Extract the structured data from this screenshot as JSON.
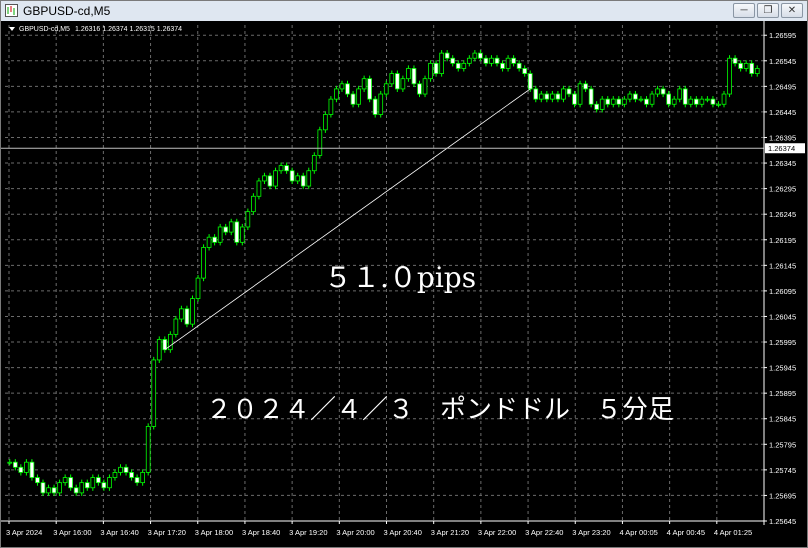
{
  "window": {
    "title": "GBPUSD-cd,M5",
    "buttons": [
      "minimize",
      "restore",
      "close"
    ]
  },
  "chart_header": {
    "symbol": "GBPUSD-cd,M5",
    "ohlc": "1.26316 1.26374 1.26315 1.26374"
  },
  "annotations": {
    "pips_label": "５１.０pips",
    "caption": "２０２４／４／３　ポンドドル　５分足"
  },
  "colors": {
    "background": "#000000",
    "grid": "#6b6b6b",
    "candle": "#00ff00",
    "axis_text": "#ffffff"
  },
  "chart_data": {
    "type": "candlestick",
    "y_ticks": [
      "1.26595",
      "1.26545",
      "1.26495",
      "1.26445",
      "1.26395",
      "1.26345",
      "1.26295",
      "1.26245",
      "1.26195",
      "1.26145",
      "1.26095",
      "1.26045",
      "1.25995",
      "1.25945",
      "1.25895",
      "1.25845",
      "1.25795",
      "1.25745",
      "1.25695",
      "1.25645"
    ],
    "current_price": "1.26374",
    "x_ticks": [
      "3 Apr 2024",
      "3 Apr 16:00",
      "3 Apr 16:40",
      "3 Apr 17:20",
      "3 Apr 18:00",
      "3 Apr 18:40",
      "3 Apr 19:20",
      "3 Apr 20:00",
      "3 Apr 20:40",
      "3 Apr 21:20",
      "3 Apr 22:00",
      "3 Apr 22:40",
      "3 Apr 23:20",
      "4 Apr 00:05",
      "4 Apr 00:45",
      "4 Apr 01:25"
    ],
    "ylim": [
      1.25645,
      1.26615
    ],
    "closes": [
      1.2576,
      1.2575,
      1.2574,
      1.2576,
      1.2573,
      1.2572,
      1.257,
      1.2571,
      1.257,
      1.2572,
      1.2573,
      1.2571,
      1.257,
      1.2572,
      1.2571,
      1.2573,
      1.2572,
      1.2571,
      1.2573,
      1.2574,
      1.2575,
      1.2574,
      1.2573,
      1.2572,
      1.2574,
      1.2583,
      1.2596,
      1.26,
      1.2598,
      1.2601,
      1.2604,
      1.2606,
      1.2603,
      1.2608,
      1.2612,
      1.2618,
      1.262,
      1.2619,
      1.2622,
      1.2621,
      1.2623,
      1.2619,
      1.2622,
      1.2625,
      1.2628,
      1.2631,
      1.2632,
      1.263,
      1.2633,
      1.2634,
      1.2633,
      1.2631,
      1.2632,
      1.263,
      1.2633,
      1.2636,
      1.2641,
      1.2644,
      1.2647,
      1.2649,
      1.265,
      1.2648,
      1.2646,
      1.2649,
      1.2651,
      1.2647,
      1.2644,
      1.2648,
      1.265,
      1.2652,
      1.2649,
      1.2651,
      1.2653,
      1.265,
      1.2648,
      1.2651,
      1.2654,
      1.2652,
      1.2656,
      1.2655,
      1.2654,
      1.2653,
      1.2654,
      1.2655,
      1.2656,
      1.2655,
      1.2654,
      1.2655,
      1.2654,
      1.2653,
      1.2655,
      1.2654,
      1.2653,
      1.2652,
      1.2649,
      1.2647,
      1.2648,
      1.2647,
      1.2648,
      1.2647,
      1.2649,
      1.2648,
      1.2646,
      1.265,
      1.2649,
      1.2646,
      1.2645,
      1.2647,
      1.2646,
      1.2647,
      1.2646,
      1.2647,
      1.2648,
      1.2647,
      1.2647,
      1.2646,
      1.2648,
      1.2649,
      1.2648,
      1.2646,
      1.2647,
      1.2649,
      1.2646,
      1.2647,
      1.2646,
      1.2647,
      1.2647,
      1.2646,
      1.2646,
      1.2648,
      1.2655,
      1.2654,
      1.2653,
      1.2654,
      1.2652,
      1.2653
    ],
    "trendline": {
      "from": 1.2598,
      "to": 1.2649
    }
  }
}
